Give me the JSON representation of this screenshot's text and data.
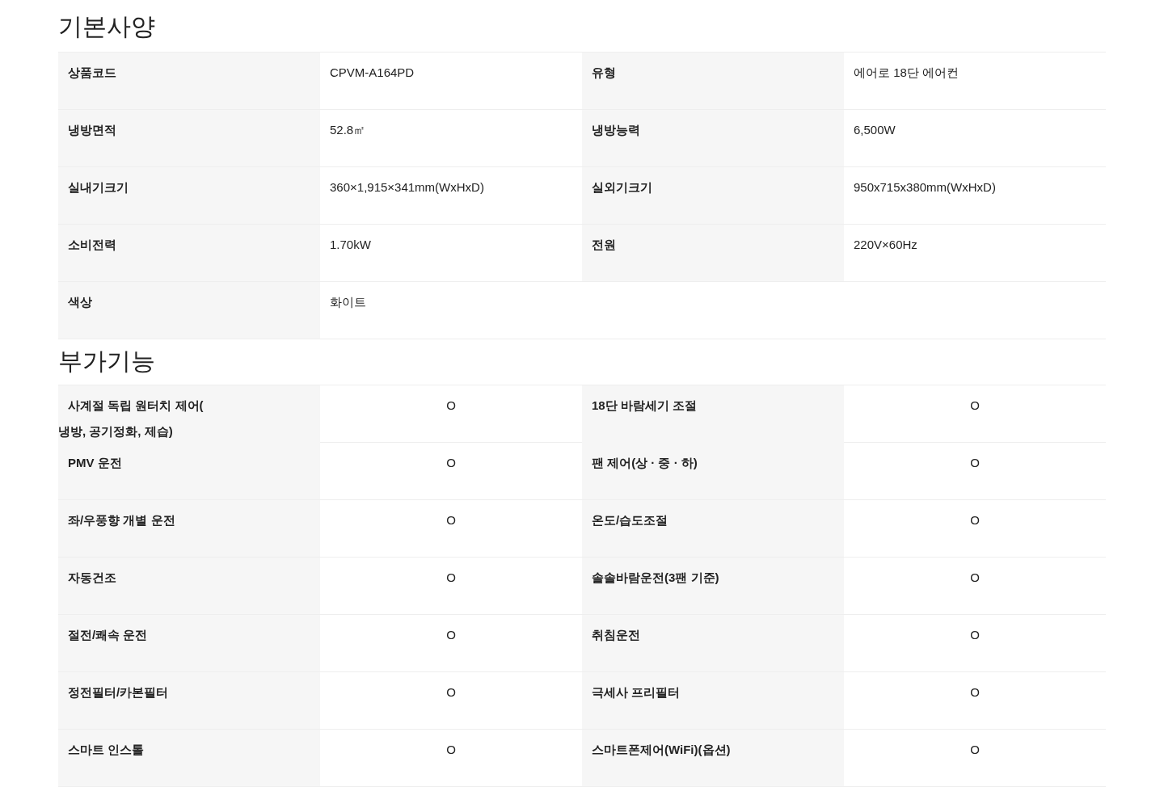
{
  "sections": [
    {
      "title": "기본사양",
      "kind": "spec",
      "rows": [
        [
          {
            "label": "상품코드",
            "value": "CPVM-A164PD"
          },
          {
            "label": "유형",
            "value": "에어로 18단 에어컨"
          }
        ],
        [
          {
            "label": "냉방면적",
            "value": "52.8㎡"
          },
          {
            "label": "냉방능력",
            "value": "6,500W"
          }
        ],
        [
          {
            "label": "실내기크기",
            "value": "360×1,915×341mm(WxHxD)"
          },
          {
            "label": "실외기크기",
            "value": "950x715x380mm(WxHxD)"
          }
        ],
        [
          {
            "label": "소비전력",
            "value": "1.70kW"
          },
          {
            "label": "전원",
            "value": "220V×60Hz"
          }
        ],
        [
          {
            "label": "색상",
            "value": "화이트"
          }
        ]
      ]
    },
    {
      "title": "부가기능",
      "kind": "feature",
      "rows": [
        [
          {
            "label": "사계절 독립 원터치 제어(\n냉방, 공기정화, 제습)",
            "value": "O"
          },
          {
            "label": "18단 바람세기 조절",
            "value": "O"
          }
        ],
        [
          {
            "label": "PMV 운전",
            "value": "O"
          },
          {
            "label": "팬 제어(상 · 중 · 하)",
            "value": "O"
          }
        ],
        [
          {
            "label": "좌/우풍향 개별 운전",
            "value": "O"
          },
          {
            "label": "온도/습도조절",
            "value": "O"
          }
        ],
        [
          {
            "label": "자동건조",
            "value": "O"
          },
          {
            "label": "솔솔바람운전(3팬 기준)",
            "value": "O"
          }
        ],
        [
          {
            "label": "절전/쾌속 운전",
            "value": "O"
          },
          {
            "label": "취침운전",
            "value": "O"
          }
        ],
        [
          {
            "label": "정전필터/카본필터",
            "value": "O"
          },
          {
            "label": "극세사 프리필터",
            "value": "O"
          }
        ],
        [
          {
            "label": "스마트 인스톨",
            "value": "O"
          },
          {
            "label": "스마트폰제어(WiFi)(옵션)",
            "value": "O"
          }
        ]
      ]
    }
  ]
}
